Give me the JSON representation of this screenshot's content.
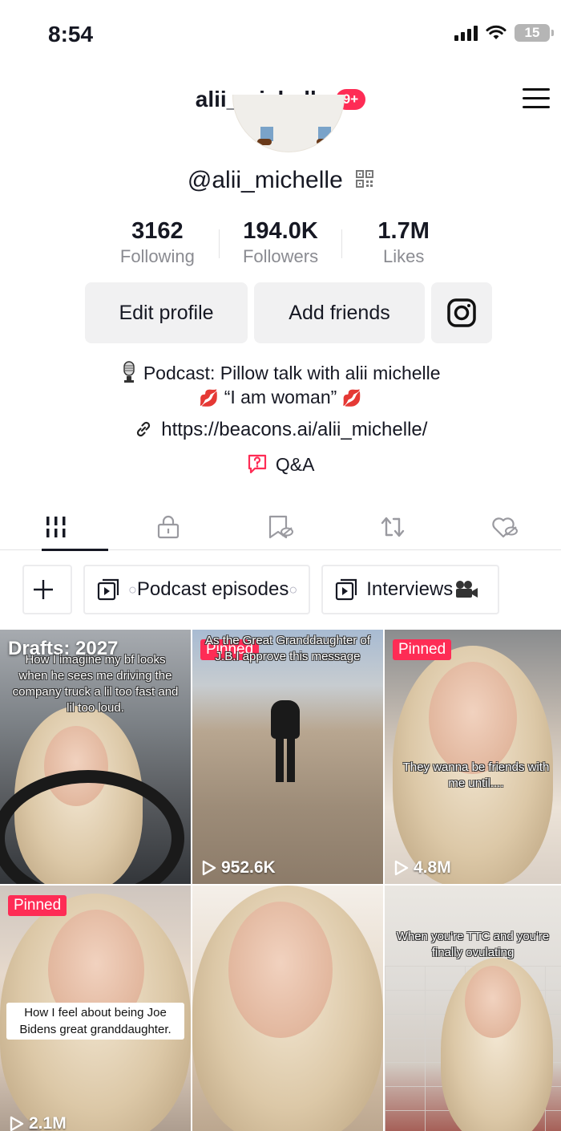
{
  "status_bar": {
    "time": "8:54",
    "battery": "15"
  },
  "header": {
    "username": "alii_michelle",
    "notification_badge": "9+"
  },
  "profile": {
    "handle": "@alii_michelle"
  },
  "stats": [
    {
      "value": "3162",
      "label": "Following"
    },
    {
      "value": "194.0K",
      "label": "Followers"
    },
    {
      "value": "1.7M",
      "label": "Likes"
    }
  ],
  "actions": {
    "edit_profile": "Edit profile",
    "add_friends": "Add friends"
  },
  "bio": {
    "line1": "Podcast: Pillow talk with alii michelle",
    "line2": "“I am woman”",
    "link": "https://beacons.ai/alii_michelle/",
    "qa": "Q&A"
  },
  "collections": [
    {
      "label": "Podcast episodes"
    },
    {
      "label": "Interviews"
    }
  ],
  "videos": [
    {
      "drafts": "Drafts: 2027",
      "caption": "How I imagine my bf looks when he sees me driving the company truck a lil too fast and lil too loud."
    },
    {
      "pinned": "Pinned",
      "caption": "As the Great Granddaughter of J.B.I approve this message",
      "views": "952.6K"
    },
    {
      "pinned": "Pinned",
      "caption": "They wanna be friends with me until....",
      "views": "4.8M"
    },
    {
      "pinned": "Pinned",
      "caption": "How I feel about being Joe Bidens great granddaughter.",
      "views": "2.1M"
    },
    {
      "caption": ""
    },
    {
      "caption": "When you're TTC and you're finally ovulating"
    }
  ],
  "colors": {
    "accent": "#fe2c55",
    "text": "#161823",
    "muted": "#8a8b91",
    "button_bg": "#f1f1f2"
  }
}
